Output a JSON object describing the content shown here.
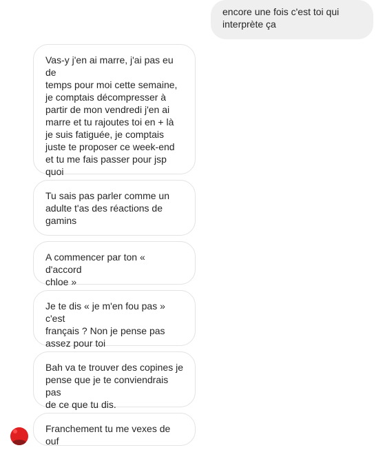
{
  "conversation": {
    "sent": [
      {
        "text": "encore une fois c'est toi qui\ninterprète ça"
      }
    ],
    "received": [
      {
        "text": "Vas-y j'en ai marre, j'ai pas eu de\ntemps pour moi cette semaine,\nje comptais décompresser à\npartir de mon vendredi j'en ai\nmarre et tu rajoutes toi en + là\nje suis fatiguée, je comptais\njuste te proposer ce week-end\net tu me fais passer pour jsp\nquoi"
      },
      {
        "text": "Tu sais pas parler comme un\nadulte t'as des réactions de\ngamins"
      },
      {
        "text": "A commencer par ton « d'accord\nchloe »"
      },
      {
        "text": "Je te dis « je m'en fou pas » c'est\nfrançais ? Non je pense pas\nassez pour toi"
      },
      {
        "text": "Bah va te trouver des copines je\npense que je te conviendrais pas\nde ce que tu dis."
      },
      {
        "text": "Franchement tu me vexes de ouf"
      }
    ]
  },
  "colors": {
    "sent_bubble": "#efefef",
    "received_bubble": "#ffffff",
    "received_border": "#e3e3e3",
    "text": "#262626",
    "avatar": "#e02020"
  },
  "icons": {
    "avatar": "contact-avatar-icon"
  }
}
